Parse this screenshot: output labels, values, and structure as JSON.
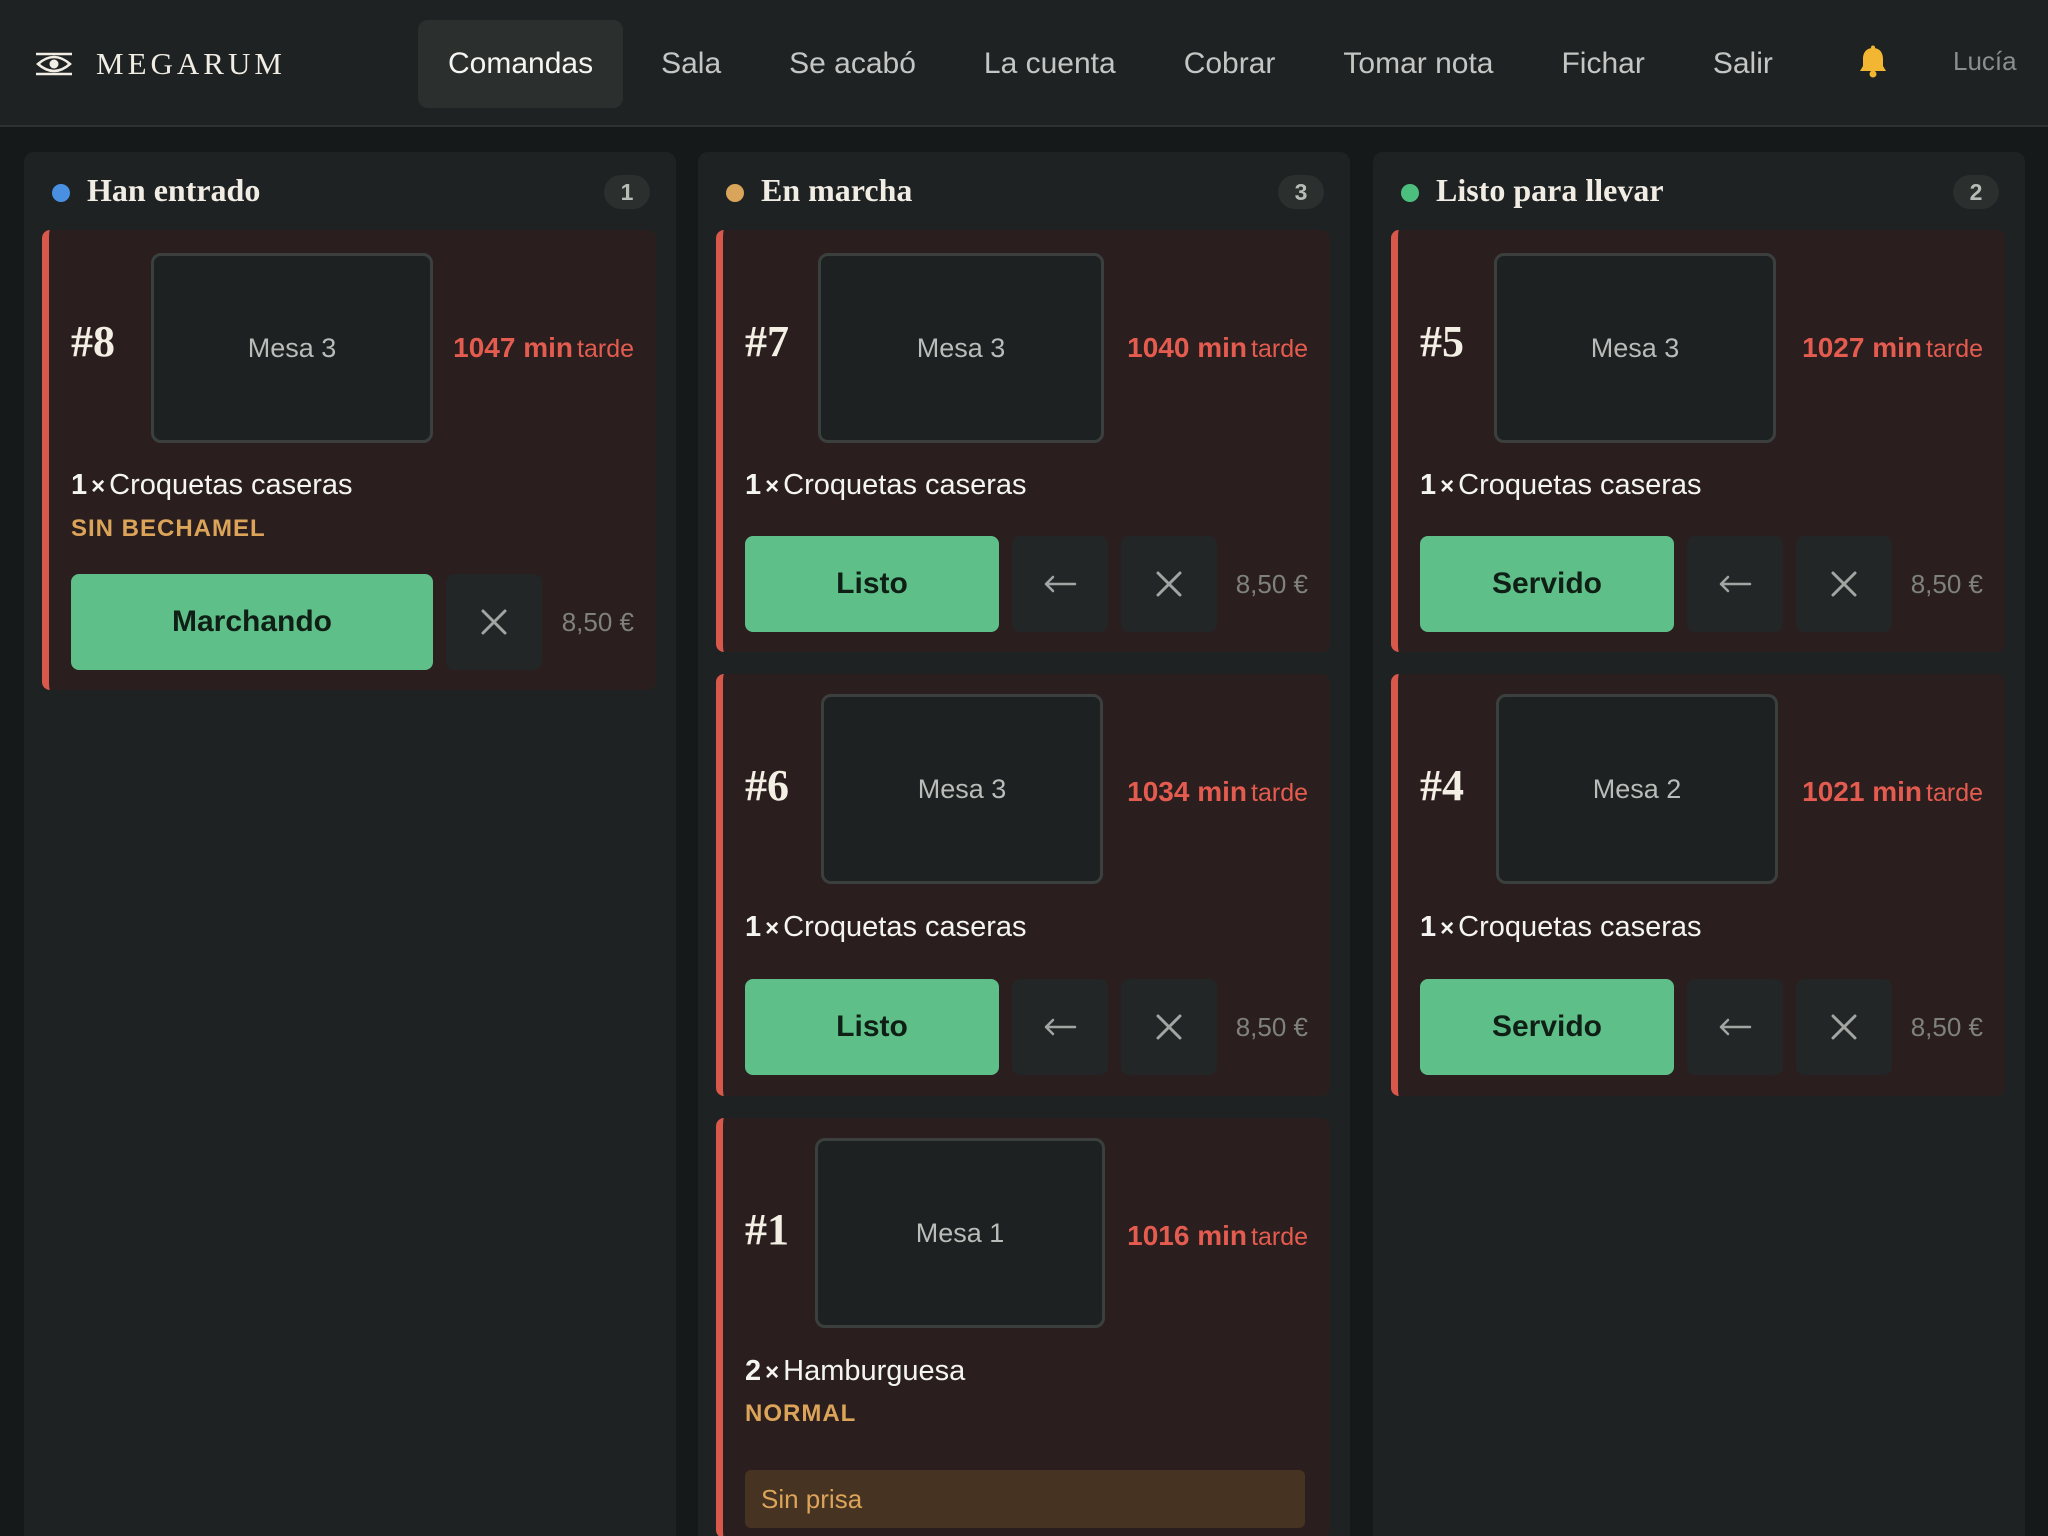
{
  "app": {
    "brand": "MEGARUM",
    "user": "Lucía"
  },
  "nav": {
    "items": [
      {
        "label": "Comandas",
        "active": true
      },
      {
        "label": "Sala"
      },
      {
        "label": "Se acabó"
      },
      {
        "label": "La cuenta"
      },
      {
        "label": "Cobrar"
      },
      {
        "label": "Tomar nota"
      },
      {
        "label": "Fichar"
      },
      {
        "label": "Salir"
      }
    ]
  },
  "colors": {
    "new": "#4a90e2",
    "in_progress": "#d9a55a",
    "ready": "#4cbf7e",
    "late": "#e45b4f",
    "primary_button": "#5fbf88",
    "modifier": "#dba459"
  },
  "columns": [
    {
      "title": "Han entrado",
      "count": "1",
      "orders": [
        {
          "number": "#8",
          "table": "Mesa 3",
          "late_minutes": "1047 min",
          "late_word": "tarde",
          "qty": "1",
          "times": "×",
          "item": "Croquetas caseras",
          "modifier": "SIN BECHAMEL",
          "action": "Marchando",
          "price": "8,50 €"
        }
      ]
    },
    {
      "title": "En marcha",
      "count": "3",
      "orders": [
        {
          "number": "#7",
          "table": "Mesa 3",
          "late_minutes": "1040 min",
          "late_word": "tarde",
          "qty": "1",
          "times": "×",
          "item": "Croquetas caseras",
          "action": "Listo",
          "price": "8,50 €"
        },
        {
          "number": "#6",
          "table": "Mesa 3",
          "late_minutes": "1034 min",
          "late_word": "tarde",
          "qty": "1",
          "times": "×",
          "item": "Croquetas caseras",
          "action": "Listo",
          "price": "8,50 €"
        },
        {
          "number": "#1",
          "table": "Mesa 1",
          "late_minutes": "1016 min",
          "late_word": "tarde",
          "qty": "2",
          "times": "×",
          "item": "Hamburguesa",
          "modifier": "NORMAL",
          "note": "Sin prisa"
        }
      ]
    },
    {
      "title": "Listo para llevar",
      "count": "2",
      "orders": [
        {
          "number": "#5",
          "table": "Mesa 3",
          "late_minutes": "1027 min",
          "late_word": "tarde",
          "qty": "1",
          "times": "×",
          "item": "Croquetas caseras",
          "action": "Servido",
          "price": "8,50 €"
        },
        {
          "number": "#4",
          "table": "Mesa 2",
          "late_minutes": "1021 min",
          "late_word": "tarde",
          "qty": "1",
          "times": "×",
          "item": "Croquetas caseras",
          "action": "Servido",
          "price": "8,50 €"
        }
      ]
    }
  ],
  "icons": {
    "brand": "eye-logo-icon",
    "notifications": "bell-icon",
    "back": "arrow-left-icon",
    "cancel": "close-icon"
  }
}
